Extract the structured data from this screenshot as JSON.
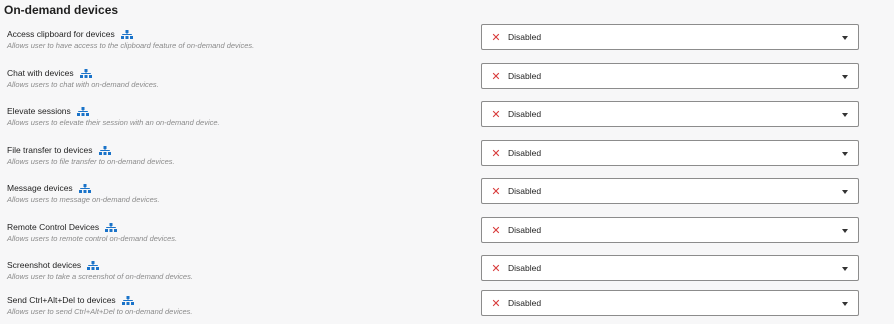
{
  "section": {
    "title": "On-demand devices"
  },
  "settings": [
    {
      "label": "Access clipboard for devices",
      "description": "Allows user to have access to the clipboard feature of on-demand devices.",
      "value": "Disabled"
    },
    {
      "label": "Chat with devices",
      "description": "Allows users to chat with on-demand devices.",
      "value": "Disabled"
    },
    {
      "label": "Elevate sessions",
      "description": "Allows users to elevate their session with an on-demand device.",
      "value": "Disabled"
    },
    {
      "label": "File transfer to devices",
      "description": "Allows users to file transfer to on-demand devices.",
      "value": "Disabled"
    },
    {
      "label": "Message devices",
      "description": "Allows users to message on-demand devices.",
      "value": "Disabled"
    },
    {
      "label": "Remote Control Devices",
      "description": "Allows users to remote control on-demand devices.",
      "value": "Disabled"
    },
    {
      "label": "Screenshot devices",
      "description": "Allows user to take a screenshot of on-demand devices.",
      "value": "Disabled"
    },
    {
      "label": "Send Ctrl+Alt+Del to devices",
      "description": "Allows user to send Ctrl+Alt+Del to on-demand devices.",
      "value": "Disabled"
    }
  ],
  "icons": {
    "inherit": "hierarchy-icon",
    "disabled": "x-icon",
    "dropdown": "chevron-down-icon"
  },
  "colors": {
    "hierarchy_icon": "#1a73c9",
    "disabled_x": "#d83a3a"
  }
}
